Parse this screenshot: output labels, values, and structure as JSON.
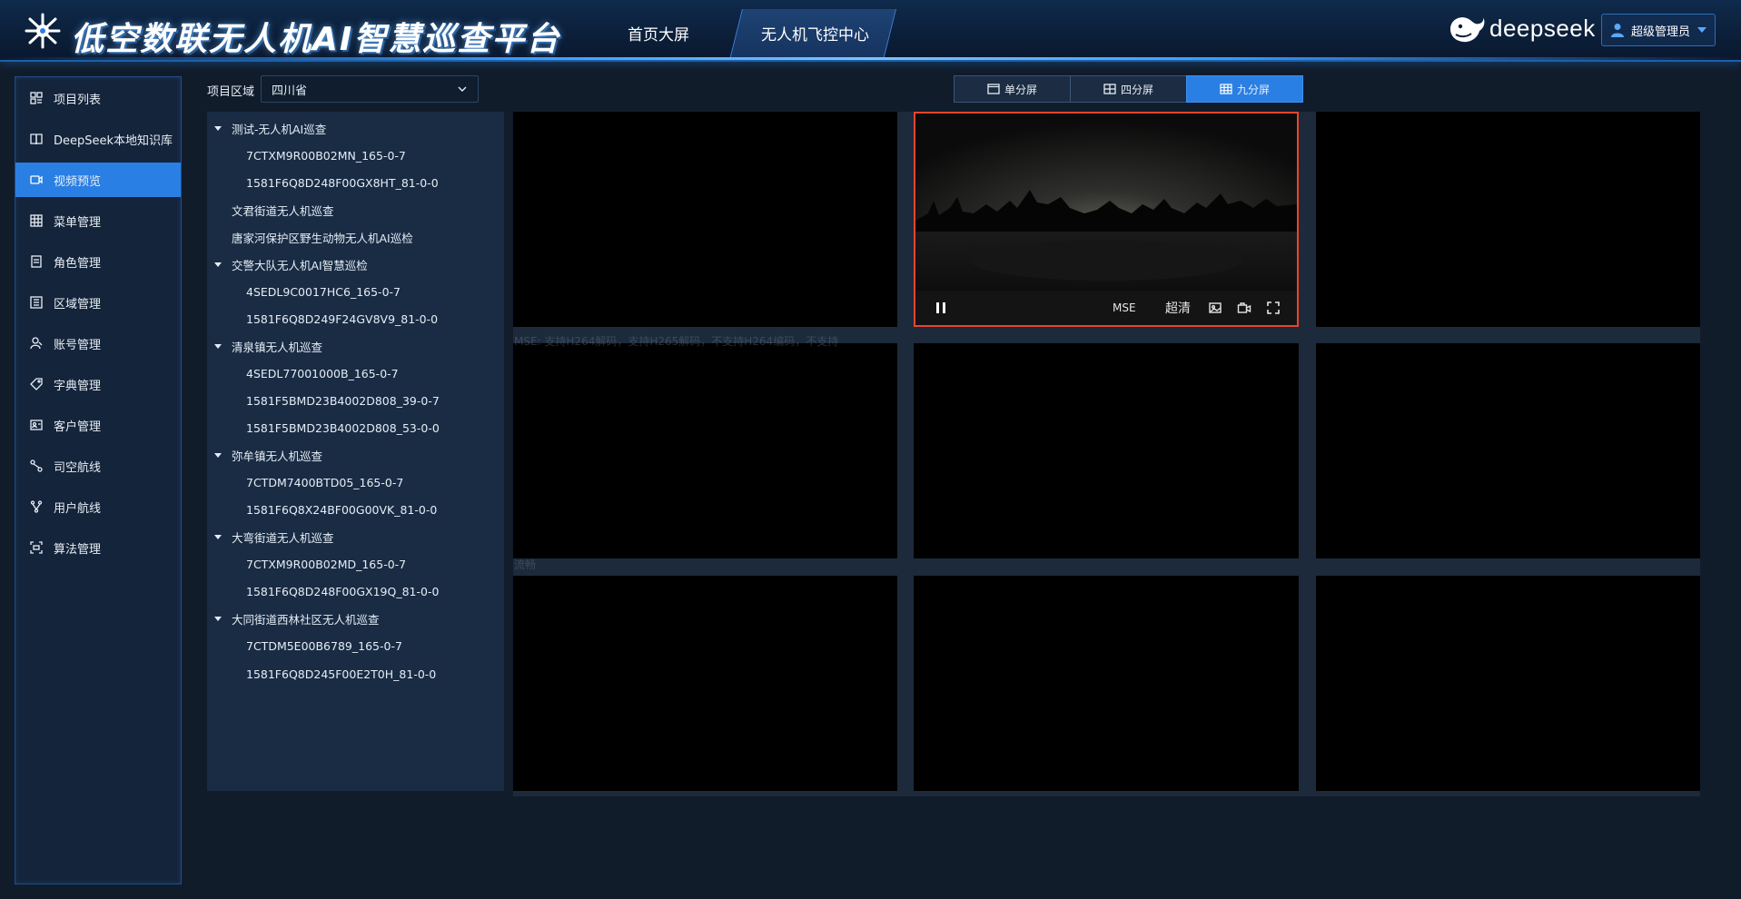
{
  "header": {
    "app_title": "低空数联无人机AI智慧巡查平台",
    "nav": [
      {
        "label": "首页大屏",
        "active": false
      },
      {
        "label": "无人机飞控中心",
        "active": true
      }
    ],
    "brand_text": "deepseek",
    "user_label": "超级管理员"
  },
  "sidebar": {
    "items": [
      {
        "label": "项目列表",
        "icon": "grid-list-icon",
        "active": false
      },
      {
        "label": "DeepSeek本地知识库",
        "icon": "book-icon",
        "active": false
      },
      {
        "label": "视频预览",
        "icon": "video-camera-icon",
        "active": true
      },
      {
        "label": "菜单管理",
        "icon": "table-icon",
        "active": false
      },
      {
        "label": "角色管理",
        "icon": "document-icon",
        "active": false
      },
      {
        "label": "区域管理",
        "icon": "list-box-icon",
        "active": false
      },
      {
        "label": "账号管理",
        "icon": "user-account-icon",
        "active": false
      },
      {
        "label": "字典管理",
        "icon": "tag-icon",
        "active": false
      },
      {
        "label": "客户管理",
        "icon": "id-card-icon",
        "active": false
      },
      {
        "label": "司空航线",
        "icon": "route-icon",
        "active": false
      },
      {
        "label": "用户航线",
        "icon": "fork-icon",
        "active": false
      },
      {
        "label": "算法管理",
        "icon": "scan-icon",
        "active": false
      }
    ]
  },
  "toolbar": {
    "region_label": "项目区域",
    "region_value": "四川省",
    "split_buttons": [
      {
        "label": "单分屏",
        "icon": "single-screen-icon",
        "active": false
      },
      {
        "label": "四分屏",
        "icon": "quad-screen-icon",
        "active": false
      },
      {
        "label": "九分屏",
        "icon": "nine-screen-icon",
        "active": true
      }
    ]
  },
  "tree": [
    {
      "type": "group",
      "label": "测试-无人机AI巡查"
    },
    {
      "type": "leaf",
      "label": "7CTXM9R00B02MN_165-0-7"
    },
    {
      "type": "leaf",
      "label": "1581F6Q8D248F00GX8HT_81-0-0"
    },
    {
      "type": "plain",
      "label": "文君街道无人机巡查"
    },
    {
      "type": "plain",
      "label": "唐家河保护区野生动物无人机AI巡检"
    },
    {
      "type": "group",
      "label": "交警大队无人机AI智慧巡检"
    },
    {
      "type": "leaf",
      "label": "4SEDL9C0017HC6_165-0-7"
    },
    {
      "type": "leaf",
      "label": "1581F6Q8D249F24GV8V9_81-0-0"
    },
    {
      "type": "group",
      "label": "清泉镇无人机巡查"
    },
    {
      "type": "leaf",
      "label": "4SEDL77001000B_165-0-7"
    },
    {
      "type": "leaf",
      "label": "1581F5BMD23B4002D808_39-0-7"
    },
    {
      "type": "leaf",
      "label": "1581F5BMD23B4002D808_53-0-0"
    },
    {
      "type": "group",
      "label": "弥牟镇无人机巡查"
    },
    {
      "type": "leaf",
      "label": "7CTDM7400BTD05_165-0-7"
    },
    {
      "type": "leaf",
      "label": "1581F6Q8X24BF00G00VK_81-0-0"
    },
    {
      "type": "group",
      "label": "大弯街道无人机巡查"
    },
    {
      "type": "leaf",
      "label": "7CTXM9R00B02MD_165-0-7"
    },
    {
      "type": "leaf",
      "label": "1581F6Q8D248F00GX19Q_81-0-0"
    },
    {
      "type": "group",
      "label": "大同街道西林社区无人机巡查"
    },
    {
      "type": "leaf",
      "label": "7CTDM5E00B6789_165-0-7"
    },
    {
      "type": "leaf",
      "label": "1581F6Q8D245F00E2T0H_81-0-0"
    }
  ],
  "player": {
    "mse_label": "MSE",
    "quality_label": "超清"
  },
  "ghost_text": {
    "line1": "MSE: 支持H264解码，支持H265解码，不支持H264编码，不支持",
    "line2": "流畅"
  }
}
